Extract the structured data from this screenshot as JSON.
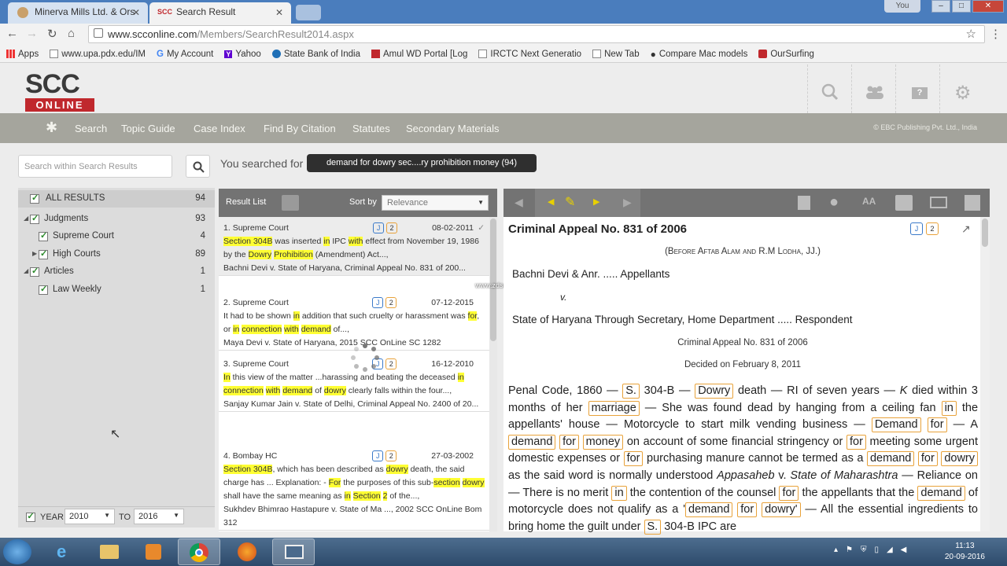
{
  "browser": {
    "tabs": [
      {
        "label": "Minerva Mills Ltd. & Ors",
        "active": false
      },
      {
        "label": "Search Result",
        "active": true
      }
    ],
    "user_badge": "You",
    "url_host": "www.scconline.com",
    "url_path": "/Members/SearchResult2014.aspx",
    "bookmarks": [
      "Apps",
      "www.upa.pdx.edu/IM",
      "My Account",
      "Yahoo",
      "State Bank of India",
      "Amul WD Portal [Log",
      "IRCTC Next Generatio",
      "New Tab",
      "Compare Mac models",
      "OurSurfing"
    ]
  },
  "scc": {
    "logo_top": "SCC",
    "logo_bottom": "ONLINE",
    "nav": [
      "Search",
      "Topic Guide",
      "Case Index",
      "Find By Citation",
      "Statutes",
      "Secondary Materials"
    ],
    "copyright": "© EBC Publishing Pvt. Ltd., India"
  },
  "search": {
    "placeholder": "Search within Search Results",
    "you_searched_label": "You searched for :",
    "query_chip": "demand for dowry sec....ry prohibition money (94)"
  },
  "facets": [
    {
      "label": "ALL RESULTS",
      "count": "94"
    },
    {
      "label": "Judgments",
      "count": "93"
    },
    {
      "label": "Supreme Court",
      "count": "4"
    },
    {
      "label": "High Courts",
      "count": "89"
    },
    {
      "label": "Articles",
      "count": "1"
    },
    {
      "label": "Law Weekly",
      "count": "1"
    }
  ],
  "year_filter": {
    "year_label": "YEAR",
    "from": "2010",
    "to_label": "TO",
    "to": "2016"
  },
  "result_list": {
    "title": "Result List",
    "sort_label": "Sort by",
    "sort_value": "Relevance",
    "items": [
      {
        "num": "1.",
        "court": "Supreme Court",
        "j": "J",
        "n": "2",
        "date": "08-02-2011",
        "snippet": [
          [
            "Section 304B",
            1
          ],
          [
            " was inserted ",
            0
          ],
          [
            "in",
            1
          ],
          [
            " IPC ",
            0
          ],
          [
            "with",
            1
          ],
          [
            " effect from November 19, 1986 by the ",
            0
          ],
          [
            "Dowry",
            1
          ],
          [
            " ",
            0
          ],
          [
            "Prohibition",
            1
          ],
          [
            " (Amendment) Act...,",
            0
          ]
        ],
        "citation": "Bachni Devi v. State of Haryana, Criminal Appeal No. 831 of 200..."
      },
      {
        "num": "2.",
        "court": "Supreme Court",
        "j": "J",
        "n": "2",
        "date": "07-12-2015",
        "snippet": [
          [
            "It had to be shown ",
            0
          ],
          [
            "in",
            1
          ],
          [
            " addition that such cruelty or harassment was ",
            0
          ],
          [
            "for",
            1
          ],
          [
            ", or ",
            0
          ],
          [
            "in",
            1
          ],
          [
            " ",
            0
          ],
          [
            "connection",
            1
          ],
          [
            " ",
            0
          ],
          [
            "with",
            1
          ],
          [
            " ",
            0
          ],
          [
            "demand",
            1
          ],
          [
            " of...,",
            0
          ]
        ],
        "citation": "Maya Devi v. State of Haryana, 2015 SCC OnLine SC 1282"
      },
      {
        "num": "3.",
        "court": "Supreme Court",
        "j": "J",
        "n": "2",
        "date": "16-12-2010",
        "snippet": [
          [
            "In",
            1
          ],
          [
            " this view of the matter ...harassing and beating the deceased ",
            0
          ],
          [
            "in",
            1
          ],
          [
            " ",
            0
          ],
          [
            "connection",
            1
          ],
          [
            " ",
            0
          ],
          [
            "with",
            1
          ],
          [
            " ",
            0
          ],
          [
            "demand",
            1
          ],
          [
            " of ",
            0
          ],
          [
            "dowry",
            1
          ],
          [
            " clearly falls within the four...,",
            0
          ]
        ],
        "citation": "Sanjay Kumar Jain v. State of Delhi, Criminal Appeal No. 2400 of 20..."
      },
      {
        "num": "4.",
        "court": "Bombay HC",
        "j": "J",
        "n": "2",
        "date": "27-03-2002",
        "snippet": [
          [
            "Section 304B",
            1
          ],
          [
            ", which has been described as ",
            0
          ],
          [
            "dowry",
            1
          ],
          [
            " death, the said charge has ... Explanation: - ",
            0
          ],
          [
            "For",
            1
          ],
          [
            " the purposes of this sub-",
            0
          ],
          [
            "section",
            1
          ],
          [
            " ",
            0
          ],
          [
            "dowry",
            1
          ],
          [
            " shall have the same meaning as ",
            0
          ],
          [
            "in",
            1
          ],
          [
            " ",
            0
          ],
          [
            "Section",
            1
          ],
          [
            " ",
            0
          ],
          [
            "2",
            1
          ],
          [
            " of the...,",
            0
          ]
        ],
        "citation": "Sukhdev Bhimrao Hastapure v. State of Ma ..., 2002 SCC OnLine Bom 312"
      }
    ]
  },
  "document": {
    "title": "Criminal Appeal No. 831 of 2006",
    "j": "J",
    "n": "2",
    "bench": "(Before Aftab Alam and R.M Lodha, JJ.)",
    "appellant": "Bachni Devi & Anr. ..... Appellants",
    "versus": "v.",
    "respondent": "State of Haryana Through Secretary, Home Department ..... Respondent",
    "case_no": "Criminal Appeal No. 831 of 2006",
    "decided": "Decided on February 8, 2011",
    "headnote": [
      [
        "Penal Code, 1860 — ",
        0
      ],
      [
        "S.",
        1
      ],
      [
        " 304-B — ",
        0
      ],
      [
        "Dowry",
        1
      ],
      [
        " death — RI of seven years — ",
        0
      ],
      [
        "K",
        2
      ],
      [
        " died within 3 months of her ",
        0
      ],
      [
        "marriage",
        1
      ],
      [
        " — She was found dead by hanging from a ceiling fan ",
        0
      ],
      [
        "in",
        1
      ],
      [
        " the appellants' house — Motorcycle to start milk vending business — ",
        0
      ],
      [
        "Demand",
        1
      ],
      [
        " ",
        0
      ],
      [
        "for",
        1
      ],
      [
        " — A ",
        0
      ],
      [
        "demand",
        1
      ],
      [
        " ",
        0
      ],
      [
        "for",
        1
      ],
      [
        " ",
        0
      ],
      [
        "money",
        1
      ],
      [
        " on account of some financial stringency or ",
        0
      ],
      [
        "for",
        1
      ],
      [
        " meeting some urgent domestic expenses or ",
        0
      ],
      [
        "for",
        1
      ],
      [
        " purchasing manure cannot be termed as a ",
        0
      ],
      [
        "demand",
        1
      ],
      [
        " ",
        0
      ],
      [
        "for",
        1
      ],
      [
        " ",
        0
      ],
      [
        "dowry",
        1
      ],
      [
        " as the said word is normally understood ",
        0
      ],
      [
        "Appasaheb",
        2
      ],
      [
        " v. ",
        0
      ],
      [
        "State of Maharashtra",
        2
      ],
      [
        " — Reliance on — There is no merit ",
        0
      ],
      [
        "in",
        1
      ],
      [
        " the contention of the counsel ",
        0
      ],
      [
        "for",
        1
      ],
      [
        " the appellants that the ",
        0
      ],
      [
        "demand",
        1
      ],
      [
        " of motorcycle does not qualify as a '",
        0
      ],
      [
        "demand",
        1
      ],
      [
        " ",
        0
      ],
      [
        "for",
        1
      ],
      [
        " ",
        0
      ],
      [
        "dowry'",
        1
      ],
      [
        " — All the essential ingredients to bring home the guilt under ",
        0
      ],
      [
        "S.",
        1
      ],
      [
        " 304-B IPC are",
        0
      ]
    ]
  },
  "watermark": "www.zdsoft.com",
  "clock": {
    "time": "11:13",
    "date": "20-09-2016"
  }
}
